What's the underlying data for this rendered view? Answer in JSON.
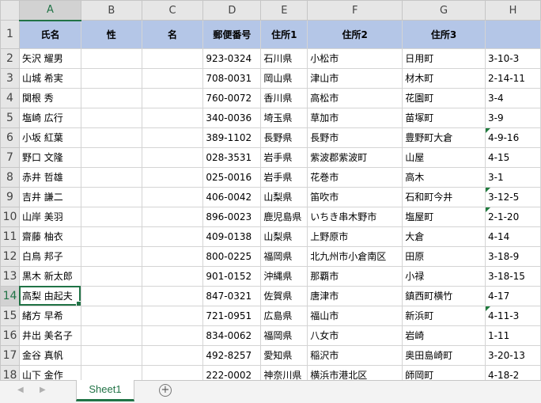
{
  "columns": [
    "A",
    "B",
    "C",
    "D",
    "E",
    "F",
    "G",
    "H"
  ],
  "active_column": "A",
  "active_row": 14,
  "header_row": [
    "氏名",
    "性",
    "名",
    "郵便番号",
    "住所1",
    "住所2",
    "住所3",
    ""
  ],
  "rows": [
    {
      "n": "2",
      "a": "矢沢 耀男",
      "b": "",
      "c": "",
      "d": "923-0324",
      "e": "石川県",
      "f": "小松市",
      "g": "日用町",
      "h": "3-10-3",
      "flag": false
    },
    {
      "n": "3",
      "a": "山城 希実",
      "b": "",
      "c": "",
      "d": "708-0031",
      "e": "岡山県",
      "f": "津山市",
      "g": "材木町",
      "h": "2-14-11",
      "flag": false
    },
    {
      "n": "4",
      "a": "関根 秀",
      "b": "",
      "c": "",
      "d": "760-0072",
      "e": "香川県",
      "f": "高松市",
      "g": "花園町",
      "h": "3-4",
      "flag": false
    },
    {
      "n": "5",
      "a": "塩崎 広行",
      "b": "",
      "c": "",
      "d": "340-0036",
      "e": "埼玉県",
      "f": "草加市",
      "g": "苗塚町",
      "h": "3-9",
      "flag": false
    },
    {
      "n": "6",
      "a": "小坂 紅葉",
      "b": "",
      "c": "",
      "d": "389-1102",
      "e": "長野県",
      "f": "長野市",
      "g": "豊野町大倉",
      "h": "4-9-16",
      "flag": true
    },
    {
      "n": "7",
      "a": "野口 文隆",
      "b": "",
      "c": "",
      "d": "028-3531",
      "e": "岩手県",
      "f": "紫波郡紫波町",
      "g": "山屋",
      "h": "4-15",
      "flag": false
    },
    {
      "n": "8",
      "a": "赤井 哲雄",
      "b": "",
      "c": "",
      "d": "025-0016",
      "e": "岩手県",
      "f": "花巻市",
      "g": "高木",
      "h": "3-1",
      "flag": false
    },
    {
      "n": "9",
      "a": "吉井 謙二",
      "b": "",
      "c": "",
      "d": "406-0042",
      "e": "山梨県",
      "f": "笛吹市",
      "g": "石和町今井",
      "h": "3-12-5",
      "flag": true
    },
    {
      "n": "10",
      "a": "山岸 美羽",
      "b": "",
      "c": "",
      "d": "896-0023",
      "e": "鹿児島県",
      "f": "いちき串木野市",
      "g": "塩屋町",
      "h": "2-1-20",
      "flag": true
    },
    {
      "n": "11",
      "a": "齋藤 柚衣",
      "b": "",
      "c": "",
      "d": "409-0138",
      "e": "山梨県",
      "f": "上野原市",
      "g": "大倉",
      "h": "4-14",
      "flag": false
    },
    {
      "n": "12",
      "a": "白鳥 邦子",
      "b": "",
      "c": "",
      "d": "800-0225",
      "e": "福岡県",
      "f": "北九州市小倉南区",
      "g": "田原",
      "h": "3-18-9",
      "flag": false
    },
    {
      "n": "13",
      "a": "黒木 新太郎",
      "b": "",
      "c": "",
      "d": "901-0152",
      "e": "沖縄県",
      "f": "那覇市",
      "g": "小禄",
      "h": "3-18-15",
      "flag": false
    },
    {
      "n": "14",
      "a": "高梨 由起夫",
      "b": "",
      "c": "",
      "d": "847-0321",
      "e": "佐賀県",
      "f": "唐津市",
      "g": "鎮西町横竹",
      "h": "4-17",
      "flag": false
    },
    {
      "n": "15",
      "a": "緒方 早希",
      "b": "",
      "c": "",
      "d": "721-0951",
      "e": "広島県",
      "f": "福山市",
      "g": "新浜町",
      "h": "4-11-3",
      "flag": true
    },
    {
      "n": "16",
      "a": "井出 美名子",
      "b": "",
      "c": "",
      "d": "834-0062",
      "e": "福岡県",
      "f": "八女市",
      "g": "岩崎",
      "h": "1-11",
      "flag": false
    },
    {
      "n": "17",
      "a": "金谷 真帆",
      "b": "",
      "c": "",
      "d": "492-8257",
      "e": "愛知県",
      "f": "稲沢市",
      "g": "奥田島崎町",
      "h": "3-20-13",
      "flag": false
    },
    {
      "n": "18",
      "a": "山下 金作",
      "b": "",
      "c": "",
      "d": "222-0002",
      "e": "神奈川県",
      "f": "横浜市港北区",
      "g": "師岡町",
      "h": "4-18-2",
      "flag": false
    }
  ],
  "tabs": {
    "sheet_name": "Sheet1",
    "add_symbol": "+",
    "prev_symbol": "◀",
    "next_symbol": "▶"
  }
}
